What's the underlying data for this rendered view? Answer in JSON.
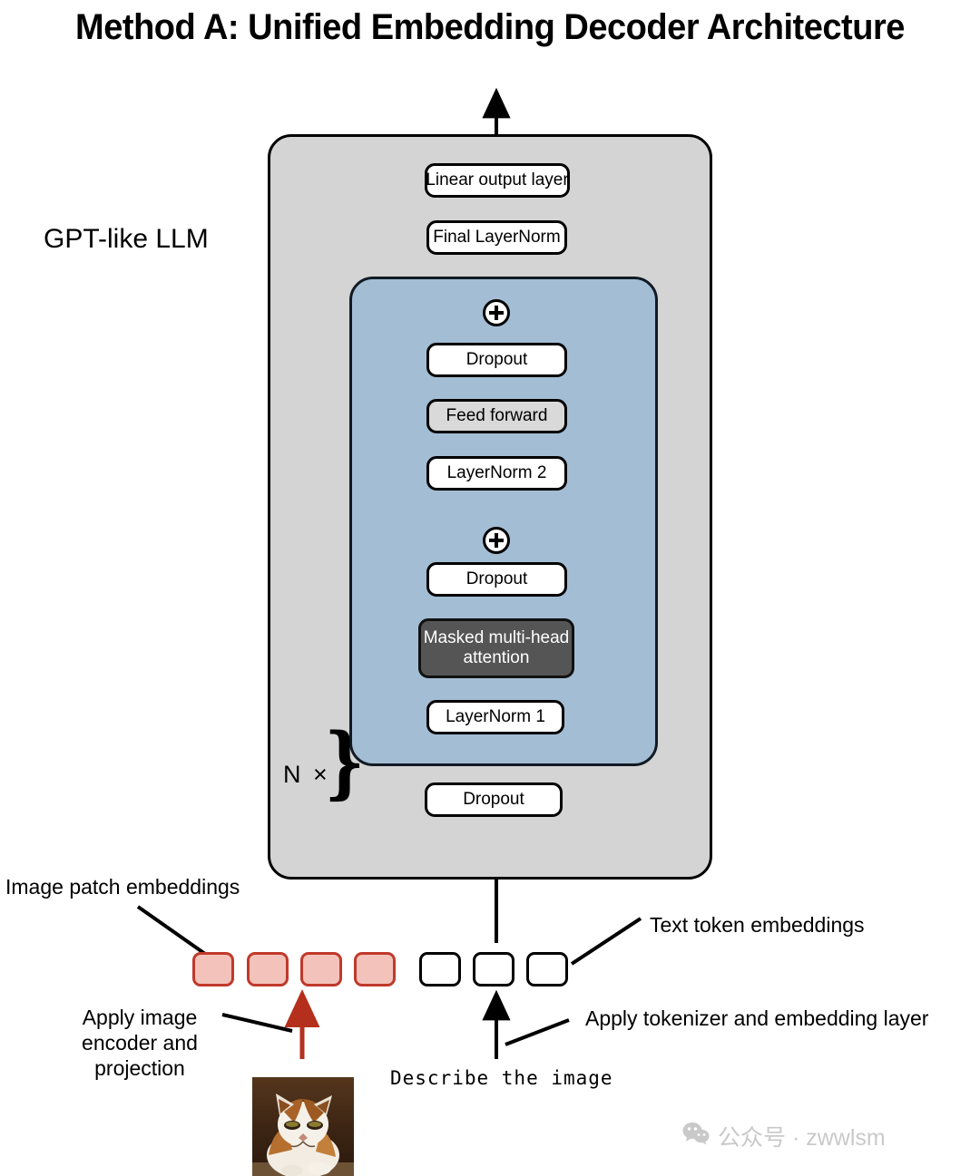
{
  "title": "Method A: Unified Embedding Decoder Architecture",
  "diagram": {
    "gpt_container_label": "GPT-like LLM",
    "repeat_label": "N ×",
    "brace_glyph": "}",
    "nodes": {
      "linear_output": "Linear output layer",
      "final_layernorm": "Final LayerNorm",
      "dropout_ffn": "Dropout",
      "feed_forward": "Feed forward",
      "layernorm2": "LayerNorm 2",
      "dropout_attn": "Dropout",
      "attention": "Masked multi-head attention",
      "attention_line1": "Masked multi-head",
      "attention_line2": "attention",
      "layernorm1": "LayerNorm 1",
      "dropout_input": "Dropout"
    },
    "residual_symbol": "+",
    "captions": {
      "image_patch_embeddings": "Image patch embeddings",
      "text_token_embeddings": "Text token embeddings",
      "apply_image_encoder": "Apply image\nencoder and\nprojection",
      "apply_image_encoder_l1": "Apply image",
      "apply_image_encoder_l2": "encoder and",
      "apply_image_encoder_l3": "projection",
      "apply_tokenizer": "Apply tokenizer and embedding layer",
      "prompt_text": "Describe the image"
    },
    "embeddings": {
      "image_patch_count": 4,
      "text_token_count": 3
    },
    "colors": {
      "gpt_container_fill": "#d4d4d4",
      "transformer_block_fill": "#a3bdd4",
      "attention_fill": "#555555",
      "feed_forward_fill": "#d9d9d9",
      "image_embedding_border": "#c0392b",
      "image_embedding_fill": "#f3c3bb",
      "image_arrow": "#b4301c",
      "stroke": "#000000"
    }
  },
  "watermark": {
    "icon": "wechat-icon",
    "text": "公众号 · zwwlsm"
  }
}
